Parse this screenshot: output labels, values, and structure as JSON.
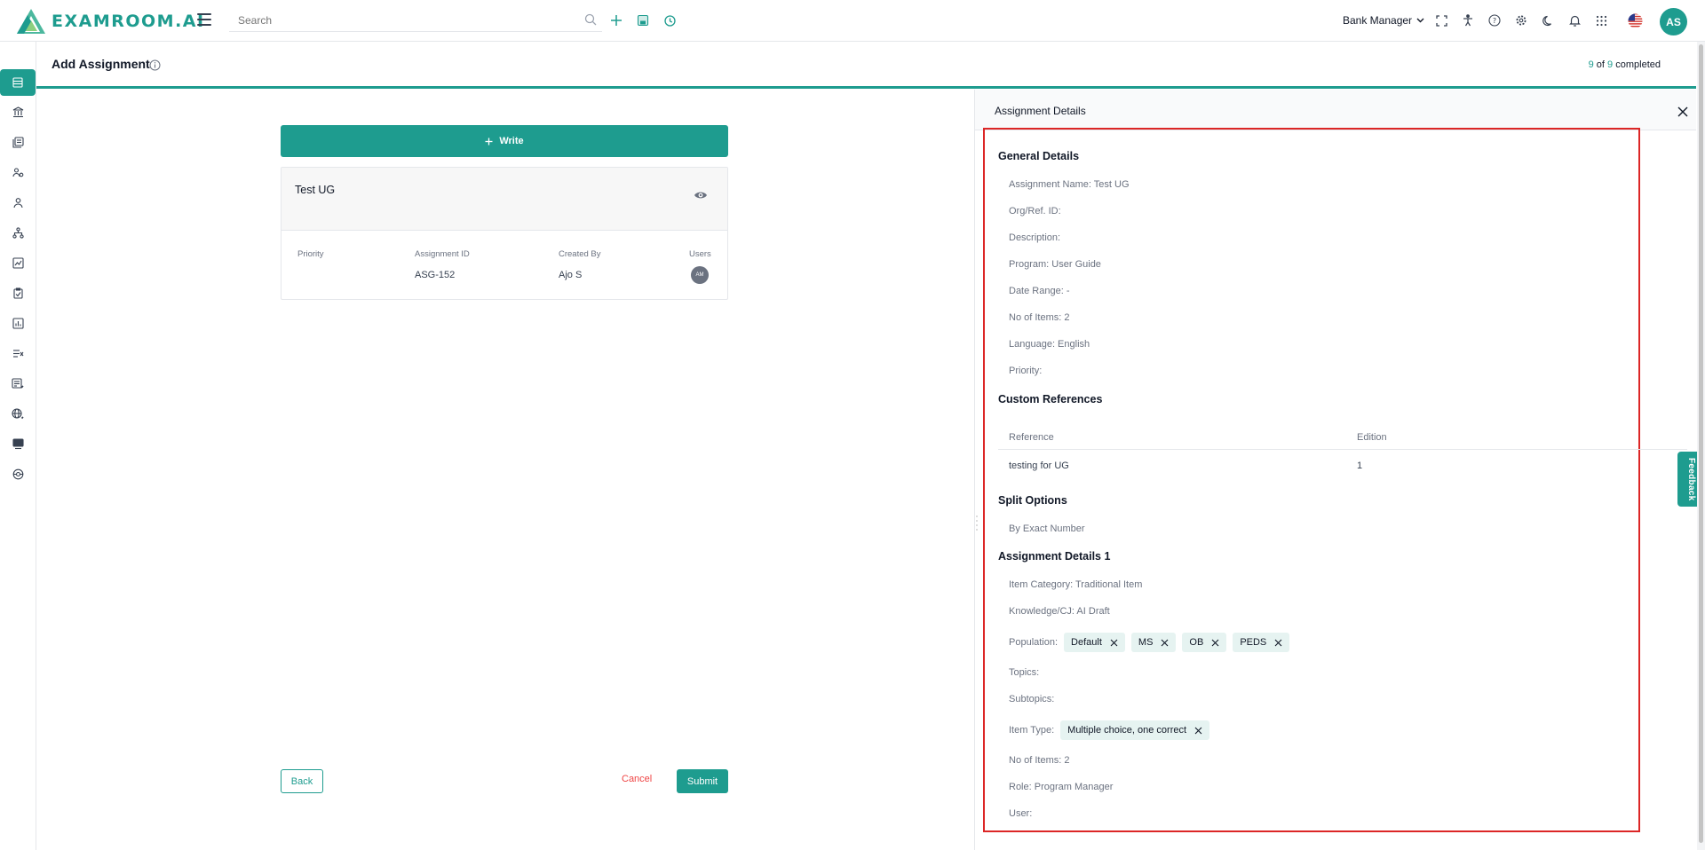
{
  "app": {
    "logo_text": "EXAMROOM.AI"
  },
  "search": {
    "placeholder": "Search"
  },
  "topbar": {
    "role": "Bank Manager",
    "avatar": "AS"
  },
  "header": {
    "title": "Add Assignment",
    "progress_done": "9",
    "progress_of": "of",
    "progress_total": "9",
    "progress_suffix": "completed"
  },
  "main": {
    "write_button": "Write",
    "card": {
      "title": "Test UG",
      "priority_label": "Priority",
      "priority_value": "",
      "assignment_id_label": "Assignment ID",
      "assignment_id_value": "ASG-152",
      "created_by_label": "Created By",
      "created_by_value": "Ajo S",
      "users_label": "Users",
      "users_avatar": "AM"
    },
    "back_button": "Back",
    "cancel_button": "Cancel",
    "submit_button": "Submit"
  },
  "panel": {
    "title": "Assignment Details",
    "general": {
      "heading": "General Details",
      "assignment_name": "Assignment Name: Test UG",
      "org_ref": "Org/Ref. ID:",
      "description": "Description:",
      "program": "Program: User Guide",
      "date_range": "Date Range: -",
      "no_items": "No of Items: 2",
      "language": "Language: English",
      "priority": "Priority:"
    },
    "custom_refs": {
      "heading": "Custom References",
      "col_reference": "Reference",
      "col_edition": "Edition",
      "rows": [
        {
          "reference": "testing for UG",
          "edition": "1"
        }
      ]
    },
    "split": {
      "heading": "Split Options",
      "value": "By Exact Number"
    },
    "details1": {
      "heading": "Assignment Details 1",
      "item_category": "Item Category: Traditional Item",
      "knowledge": "Knowledge/CJ: AI Draft",
      "population_label": "Population:",
      "population_chips": [
        "Default",
        "MS",
        "OB",
        "PEDS"
      ],
      "topics": "Topics:",
      "subtopics": "Subtopics:",
      "item_type_label": "Item Type:",
      "item_type_chips": [
        "Multiple choice, one correct"
      ],
      "no_items": "No of Items: 2",
      "role": "Role: Program Manager",
      "user": "User:"
    }
  },
  "feedback": {
    "label": "Feedback"
  },
  "colors": {
    "accent": "#1e9c8f",
    "highlight": "#dc2626",
    "cancel": "#ef4444",
    "chip_bg": "#e6f3f1"
  }
}
